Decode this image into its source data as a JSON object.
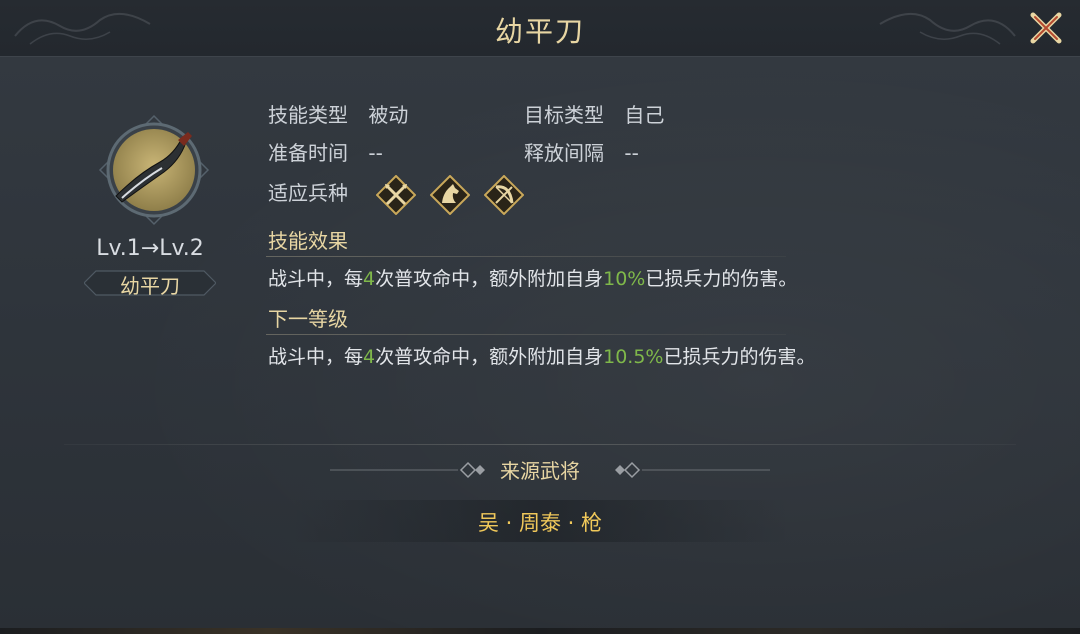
{
  "title": "幼平刀",
  "skill": {
    "level_text": "Lv.1→Lv.2",
    "name": "幼平刀"
  },
  "info": {
    "skill_type_label": "技能类型",
    "skill_type_value": "被动",
    "target_type_label": "目标类型",
    "target_type_value": "自己",
    "prep_time_label": "准备时间",
    "prep_time_value": "--",
    "interval_label": "释放间隔",
    "interval_value": "--",
    "troop_label": "适应兵种",
    "troop_icons": [
      "spear-icon",
      "horse-icon",
      "bow-icon"
    ]
  },
  "effect": {
    "title": "技能效果",
    "prefix": "战斗中，每",
    "count": "4",
    "middle": "次普攻命中，额外附加自身",
    "percent": "10%",
    "suffix": "已损兵力的伤害。"
  },
  "next": {
    "title": "下一等级",
    "prefix": "战斗中，每",
    "count": "4",
    "middle": "次普攻命中，额外附加自身",
    "percent": "10.5%",
    "suffix": "已损兵力的伤害。"
  },
  "source": {
    "title": "来源武将",
    "general": "吴 · 周泰 · 枪"
  },
  "colors": {
    "gold": "#e8d6a3",
    "highlight_green": "#7fb84a",
    "general_gold": "#f0c85a"
  }
}
